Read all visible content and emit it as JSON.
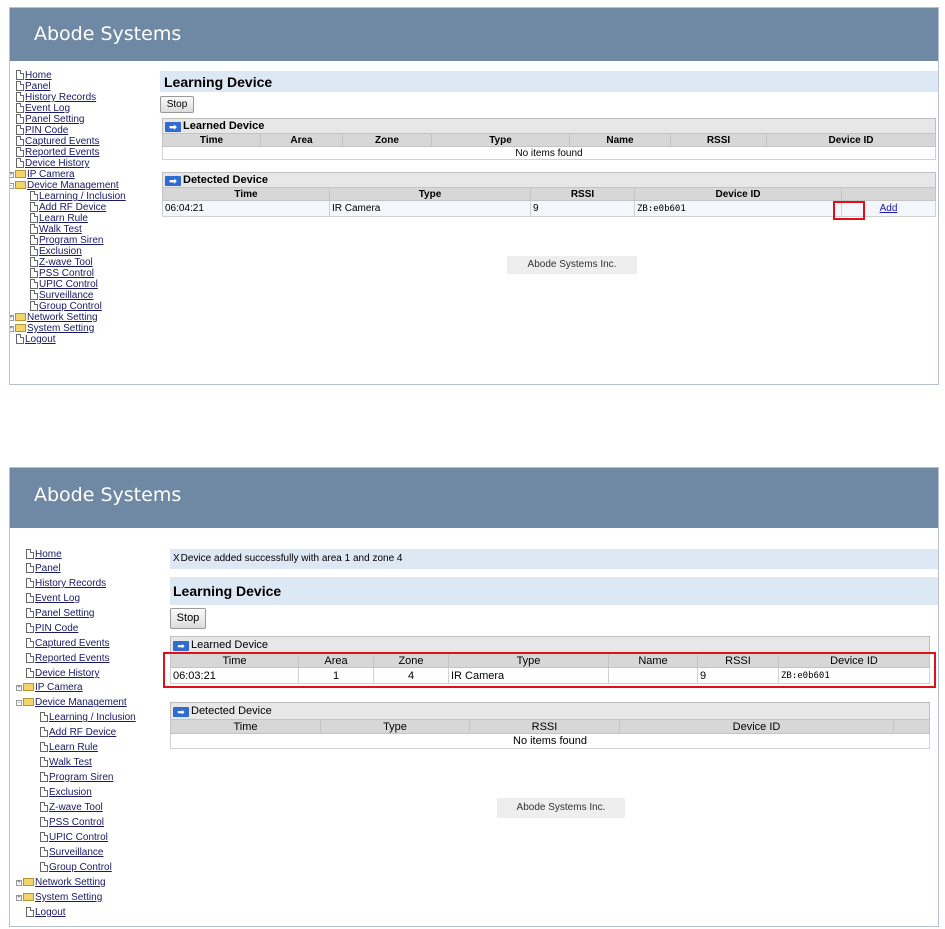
{
  "brand": "Abode Systems",
  "footer": "Abode Systems Inc.",
  "nav": {
    "home": "Home",
    "panel": "Panel",
    "history_records": "History Records",
    "event_log": "Event Log",
    "panel_setting": "Panel Setting",
    "pin_code": "PIN Code",
    "captured_events": "Captured Events",
    "reported_events": "Reported Events",
    "device_history": "Device History",
    "ip_camera": "IP Camera",
    "device_management": "Device Management",
    "learning_inclusion": "Learning / Inclusion",
    "add_rf_device": "Add RF Device",
    "learn_rule": "Learn Rule",
    "walk_test": "Walk Test",
    "program_siren": "Program Siren",
    "exclusion": "Exclusion",
    "zwave_tool": "Z-wave Tool",
    "pss_control": "PSS Control",
    "upic_control": "UPIC Control",
    "surveillance": "Surveillance",
    "group_control": "Group Control",
    "network_setting": "Network Setting",
    "system_setting": "System Setting",
    "logout": "Logout"
  },
  "page_title": "Learning Device",
  "stop_label": "Stop",
  "learned_section": "Learned Device",
  "detected_section": "Detected Device",
  "learned_columns": {
    "time": "Time",
    "area": "Area",
    "zone": "Zone",
    "type": "Type",
    "name": "Name",
    "rssi": "RSSI",
    "device_id": "Device ID"
  },
  "detected_columns": {
    "time": "Time",
    "type": "Type",
    "rssi": "RSSI",
    "device_id": "Device ID"
  },
  "no_items": "No items found",
  "screen1": {
    "detected_row": {
      "time": "06:04:21",
      "type": "IR Camera",
      "rssi": "9",
      "device_id": "ZB:e0b601",
      "action": "Add"
    }
  },
  "screen2": {
    "notice": "Device added successfully with area 1 and zone 4",
    "close_glyph": "X",
    "learned_row": {
      "time": "06:03:21",
      "area": "1",
      "zone": "4",
      "type": "IR Camera",
      "name": "",
      "rssi": "9",
      "device_id": "ZB:e0b601"
    }
  },
  "colors": {
    "header": "#6f89a4",
    "title_bar": "#dde8f5",
    "highlight": "#e0101a"
  }
}
